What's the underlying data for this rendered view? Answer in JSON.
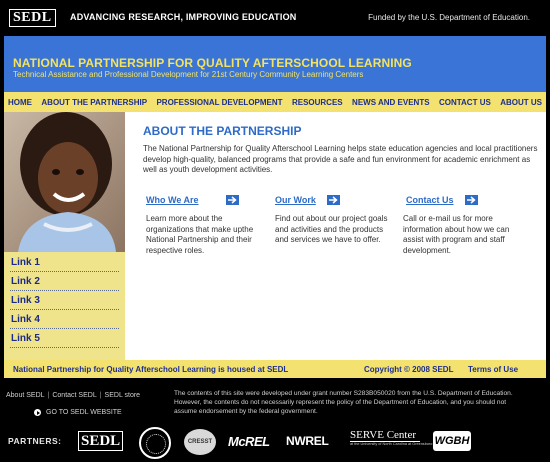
{
  "header": {
    "logo_text": "SEDL",
    "tagline": "ADVANCING RESEARCH, IMPROVING EDUCATION",
    "funded_text": "Funded by the U.S. Department of Education."
  },
  "banner": {
    "title": "NATIONAL PARTNERSHIP FOR QUALITY AFTERSCHOOL LEARNING",
    "subtitle": "Technical Assistance and Professional Development for 21st Century Community Learning Centers"
  },
  "nav": {
    "items": [
      {
        "label": "HOME"
      },
      {
        "label": "ABOUT THE PARTNERSHIP"
      },
      {
        "label": "PROFESSIONAL DEVELOPMENT"
      },
      {
        "label": "RESOURCES"
      },
      {
        "label": "NEWS AND EVENTS"
      },
      {
        "label": "CONTACT US"
      },
      {
        "label": "ABOUT US"
      }
    ]
  },
  "sidebar": {
    "links": [
      {
        "label": "Link 1"
      },
      {
        "label": "Link 2"
      },
      {
        "label": "Link 3"
      },
      {
        "label": "Link 4"
      },
      {
        "label": "Link 5"
      }
    ]
  },
  "main": {
    "title": "ABOUT THE PARTNERSHIP",
    "intro": "The National Partnership for Quality Afterschool Learning helps state education agencies and local practitioners develop high-quality, balanced programs that provide a safe and fun environment for academic enrichment as well as youth development activities.",
    "columns": [
      {
        "link": "Who We Are",
        "text": "Learn more about the organizations that make upthe National Partnership and their respective roles."
      },
      {
        "link": "Our Work",
        "text": "Find out about our project goals and activities and the products and services we have to offer."
      },
      {
        "link": "Contact Us",
        "text": "Call or e-mail us for more information about how we can assist with program and staff development."
      }
    ]
  },
  "bottom_bar": {
    "housed_text": "National Partnership for Quality Afterschool Learning is housed at SEDL",
    "copyright": "Copyright © 2008 SEDL",
    "terms": "Terms of Use"
  },
  "footer": {
    "links": [
      {
        "label": "About SEDL"
      },
      {
        "label": "Contact SEDL"
      },
      {
        "label": "SEDL store"
      }
    ],
    "separator": "|",
    "goto_label": "GO TO SEDL WEBSITE",
    "disclaimer": "The contents of this site were developed under grant number S283B050020 from the U.S. Department of Education. However, the contents do not necessarily represent the policy of the Department of Education, and you should not assume endorsement by the federal government."
  },
  "partners": {
    "label": "PARTNERS:",
    "logos": [
      {
        "text": "SEDL"
      },
      {
        "text": ""
      },
      {
        "text": "CRESST"
      },
      {
        "text": "McREL"
      },
      {
        "text": "NWREL"
      },
      {
        "text": "SERVE Center",
        "sub": "at the University of North Carolina at Greensboro"
      },
      {
        "text": "WGBH"
      }
    ]
  },
  "colors": {
    "banner_blue": "#3a74d6",
    "nav_yellow": "#f4e270",
    "title_yellow": "#f3e35f",
    "link_blue": "#2d6bc7",
    "nav_text": "#1d2f8a"
  }
}
